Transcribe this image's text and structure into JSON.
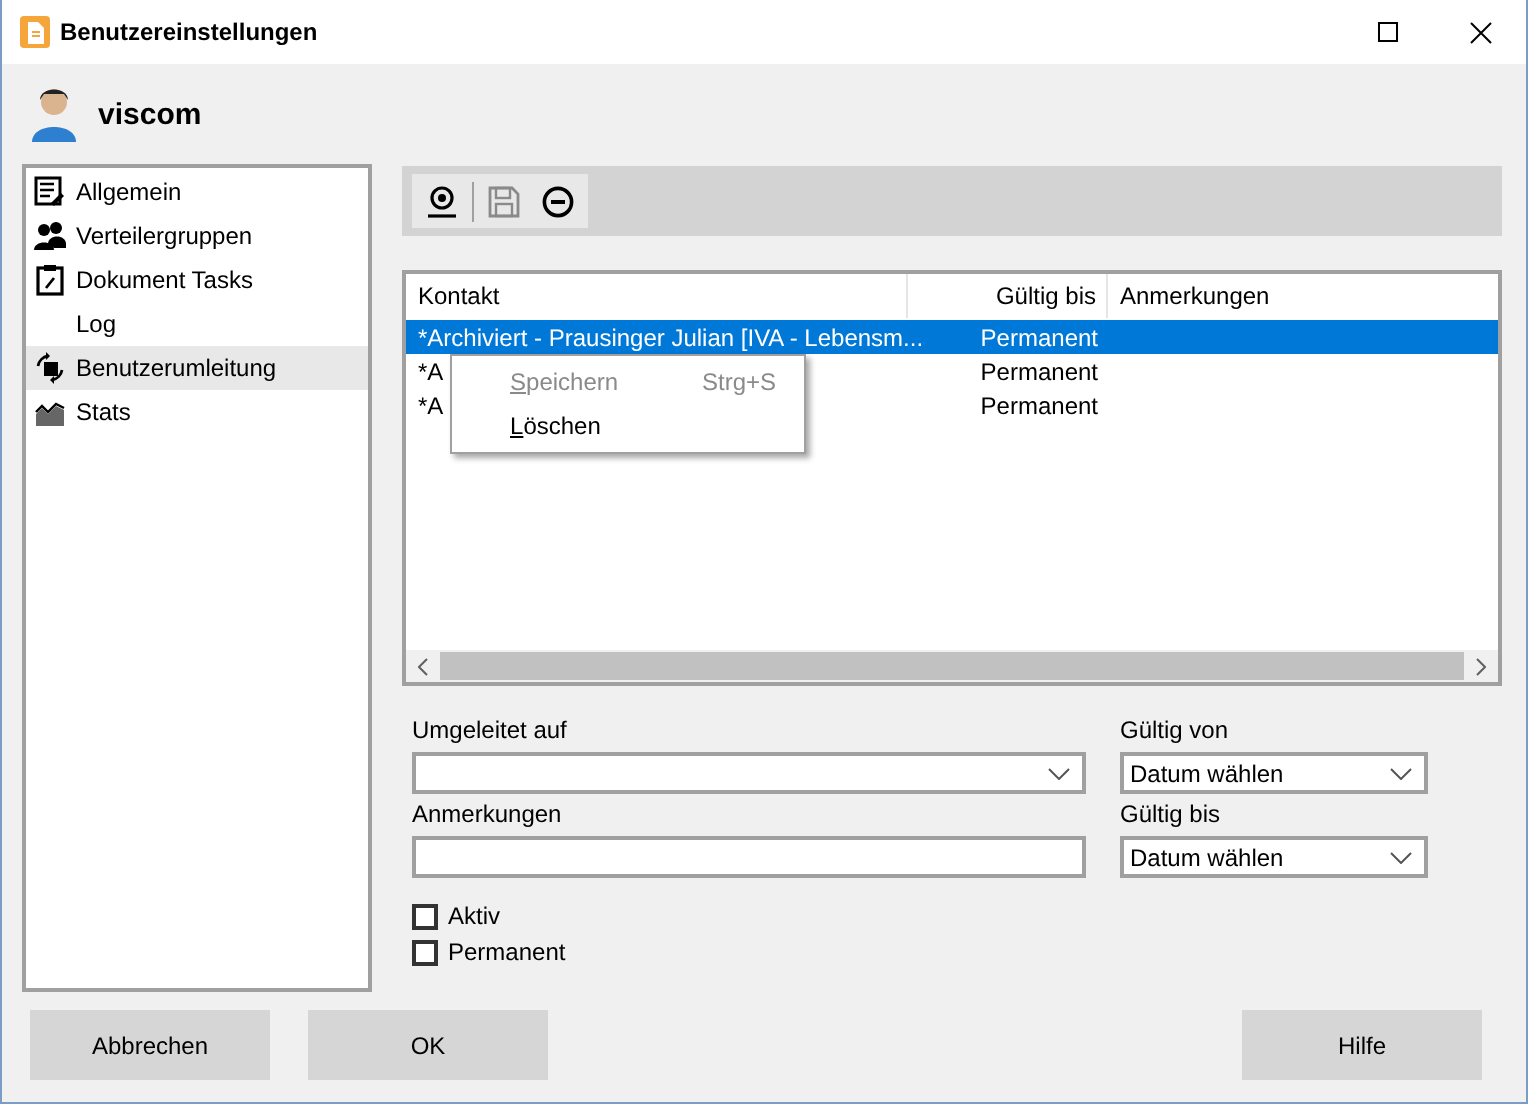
{
  "window": {
    "title": "Benutzereinstellungen"
  },
  "user": {
    "name": "viscom"
  },
  "sidebar": {
    "items": [
      {
        "label": "Allgemein",
        "kind": "list",
        "selected": false
      },
      {
        "label": "Verteilergruppen",
        "kind": "users",
        "selected": false
      },
      {
        "label": "Dokument Tasks",
        "kind": "clipboard",
        "selected": false
      },
      {
        "label": "Log",
        "kind": "none",
        "selected": false
      },
      {
        "label": "Benutzerumleitung",
        "kind": "redirect",
        "selected": true
      },
      {
        "label": "Stats",
        "kind": "chart",
        "selected": false
      }
    ]
  },
  "toolbar": {
    "buttons": [
      {
        "kind": "user-pin",
        "disabled": false
      },
      {
        "kind": "save",
        "disabled": true
      },
      {
        "kind": "remove",
        "disabled": false
      }
    ]
  },
  "table": {
    "columns": [
      "Kontakt",
      "Gültig bis",
      "Anmerkungen"
    ],
    "rows": [
      {
        "contact": "*Archiviert - Prausinger Julian [IVA - Lebensm...",
        "valid_until": "Permanent",
        "selected": true
      },
      {
        "contact": "*A",
        "valid_until": "Permanent",
        "selected": false
      },
      {
        "contact": "*A",
        "valid_until": "Permanent",
        "selected": false
      }
    ]
  },
  "context_menu": {
    "items": [
      {
        "label": "Speichern",
        "shortcut": "Strg+S",
        "disabled": true
      },
      {
        "label": "Löschen",
        "disabled": false
      }
    ]
  },
  "form": {
    "redirect_to": {
      "label": "Umgeleitet auf"
    },
    "valid_from": {
      "label": "Gültig von",
      "value": "Datum wählen"
    },
    "notes": {
      "label": "Anmerkungen"
    },
    "valid_to": {
      "label": "Gültig bis",
      "value": "Datum wählen"
    },
    "checkboxes": [
      {
        "label": "Aktiv",
        "checked": false
      },
      {
        "label": "Permanent",
        "checked": false
      }
    ]
  },
  "buttons": [
    {
      "label": "Abbrechen"
    },
    {
      "label": "OK"
    },
    {
      "label": "Hilfe"
    }
  ]
}
